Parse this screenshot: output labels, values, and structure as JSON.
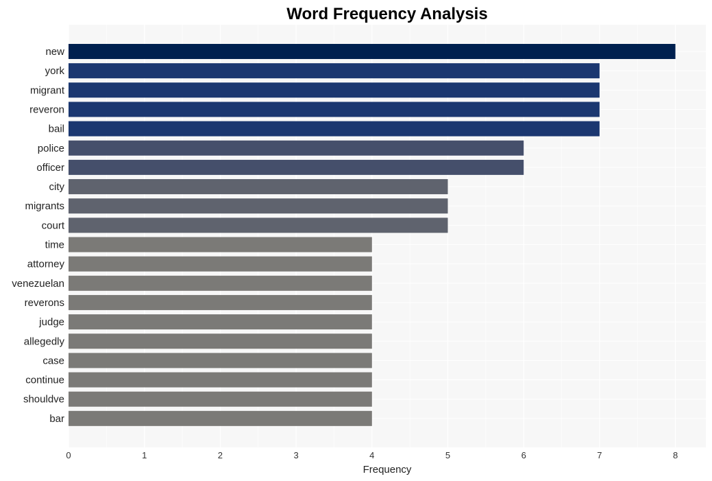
{
  "chart_data": {
    "type": "bar",
    "orientation": "horizontal",
    "title": "Word Frequency Analysis",
    "xlabel": "Frequency",
    "ylabel": "",
    "xlim": [
      0,
      8.4
    ],
    "xticks": [
      0,
      1,
      2,
      3,
      4,
      5,
      6,
      7,
      8
    ],
    "grid": true,
    "legend": "none",
    "categories": [
      "new",
      "york",
      "migrant",
      "reveron",
      "bail",
      "police",
      "officer",
      "city",
      "migrants",
      "court",
      "time",
      "attorney",
      "venezuelan",
      "reverons",
      "judge",
      "allegedly",
      "case",
      "continue",
      "shouldve",
      "bar"
    ],
    "values": [
      8,
      7,
      7,
      7,
      7,
      6,
      6,
      5,
      5,
      5,
      4,
      4,
      4,
      4,
      4,
      4,
      4,
      4,
      4,
      4
    ],
    "color_by_value": {
      "8": "#00204f",
      "7": "#1b3770",
      "6": "#454f6b",
      "5": "#5f636e",
      "4": "#7b7a77"
    },
    "background": "#f7f7f7"
  }
}
